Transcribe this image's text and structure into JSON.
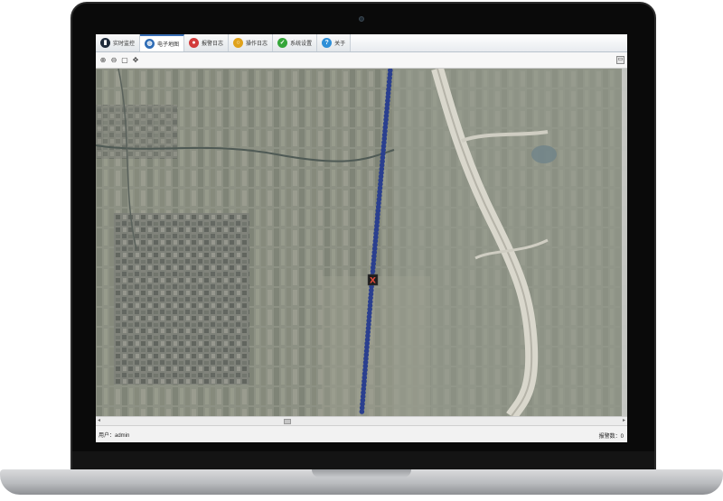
{
  "tabs": [
    {
      "label": "实时监控",
      "icon": "monitor-icon",
      "color": "#1d2a3a",
      "active": false
    },
    {
      "label": "电子地图",
      "icon": "globe-icon",
      "color": "#2f6db6",
      "active": true
    },
    {
      "label": "报警日志",
      "icon": "alarm-icon",
      "color": "#d23b3b",
      "active": false
    },
    {
      "label": "操作日志",
      "icon": "log-icon",
      "color": "#e0a21b",
      "active": false
    },
    {
      "label": "系统设置",
      "icon": "settings-icon",
      "color": "#35a63a",
      "active": false
    },
    {
      "label": "关于",
      "icon": "help-icon",
      "color": "#2e8fd8",
      "active": false
    }
  ],
  "toolbar": {
    "zoom_in": "🔍+",
    "zoom_out": "🔍-",
    "select": "⬚",
    "pan": "⊹"
  },
  "map": {
    "marker_label": "X",
    "track_color": "#2a3f8f",
    "marker_color": "#c0392b"
  },
  "status": {
    "user": "用户：admin",
    "right": "报警数：0"
  }
}
